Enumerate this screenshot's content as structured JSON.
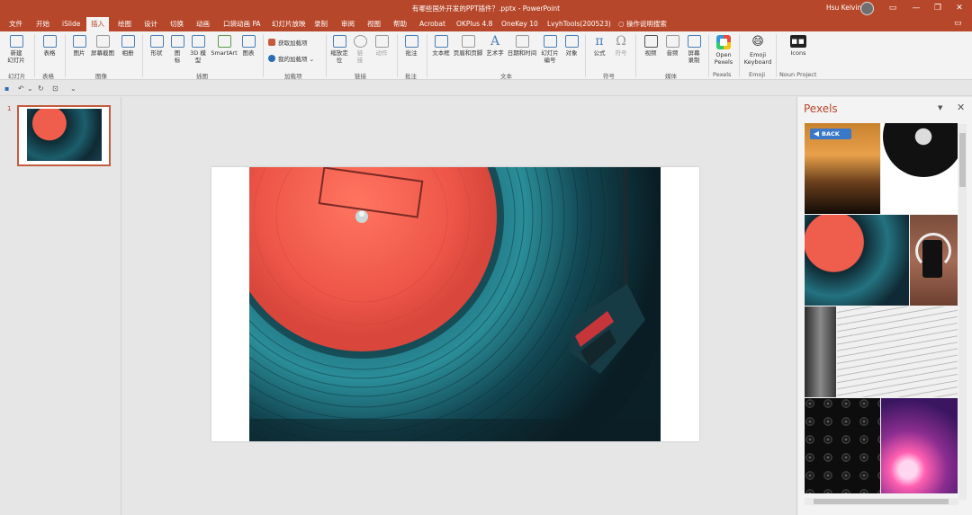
{
  "window": {
    "title": "有哪些国外开发的PPT插件？.pptx  -  PowerPoint",
    "user": "Hsu Kelvin",
    "controls": {
      "ribbon_options": "▭",
      "minimize": "—",
      "restore": "❐",
      "close": "✕"
    }
  },
  "tabs": [
    "文件",
    "开始",
    "iSlide",
    "插入",
    "绘图",
    "设计",
    "切换",
    "动画",
    "口袋动画 PA",
    "幻灯片放映",
    "录制",
    "审阅",
    "视图",
    "帮助",
    "Acrobat",
    "OKPlus 4.8",
    "OneKey 10",
    "LvyhTools(200523)",
    "操作说明搜索"
  ],
  "active_tab": "插入",
  "ribbon": {
    "new_slide": "新建\n幻灯片",
    "table": "表格",
    "picture": "图片",
    "screenshot": "屏幕截图",
    "album": "相册",
    "shapes": "形状",
    "icons": "图\n标",
    "model3d": "3D 模\n型",
    "smartart": "SmartArt",
    "chart": "图表",
    "get_addins": "获取加载项",
    "my_addins": "我的加载项",
    "zoom": "缩放定\n位",
    "link": "链\n接",
    "action": "动作",
    "comment": "批注",
    "textbox": "文本框",
    "header_footer": "页眉和页脚",
    "wordart": "艺术字",
    "date_time": "日期和时间",
    "slide_number": "幻灯片\n编号",
    "object": "对象",
    "equation": "公式",
    "symbol": "符号",
    "video": "视频",
    "audio": "音频",
    "screen_recording": "屏幕\n录制",
    "open_pexels": "Open\nPexels",
    "emoji_keyboard": "Emoji\nKeyboard",
    "icons_np": "Icons",
    "groups": {
      "slides": "幻灯片",
      "tables": "表格",
      "images": "图像",
      "illustrations": "插图",
      "addins": "加载项",
      "links": "链接",
      "comments": "批注",
      "text": "文本",
      "symbols": "符号",
      "media": "媒体",
      "pexels": "Pexels",
      "emoji": "Emoji",
      "noun_project": "Noun Project"
    }
  },
  "thumbnails": [
    {
      "number": "1"
    }
  ],
  "pexels_pane": {
    "title": "Pexels",
    "back_label": "BACK"
  }
}
